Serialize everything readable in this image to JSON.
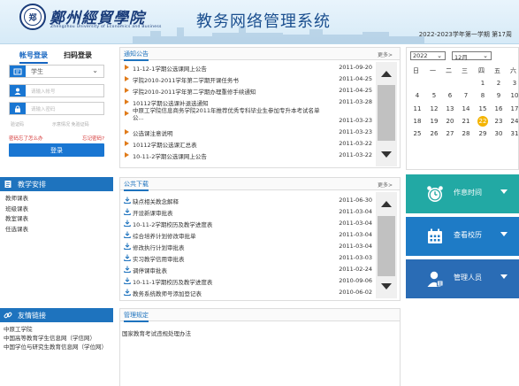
{
  "header": {
    "school_name": "鄭州經貿學院",
    "school_sub": "Zhengzhou University of Economics and Business",
    "system_title": "教务网络管理系统",
    "term_text": "2022-2023学年第一学期 第17周"
  },
  "login": {
    "tab_account": "帐号登录",
    "tab_qr": "扫码登录",
    "role_value": "学生",
    "username_placeholder": "请输入帐号",
    "password_placeholder": "请输入密码",
    "captcha_label": "验证码",
    "captcha_hint": "示意情况 免验证码",
    "link_forgot_pwd": "密码忘了怎么办",
    "link_forgot_account": "忘记密码?",
    "login_button": "登录"
  },
  "teaching": {
    "title": "教学安排",
    "items": [
      "教师课表",
      "班级课表",
      "教室课表",
      "任选课表"
    ]
  },
  "friend_links": {
    "title": "友情链接",
    "items": [
      "中原工学院",
      "中国高等教育学生信息网（学信网）",
      "中国学位与研究生教育信息网（学位网）"
    ]
  },
  "notices": {
    "title": "通知公告",
    "more": "更多>",
    "rows": [
      {
        "text": "11-12-1学期公选课网上公告",
        "date": "2011-09-20"
      },
      {
        "text": "学院2010-2011学年第二学期开课任务书",
        "date": "2011-04-25"
      },
      {
        "text": "学院2010-2011学年第二学期办理重修手续通知",
        "date": "2011-04-25"
      },
      {
        "text": "10112学期公选课补退选通知",
        "date": "2011-03-28"
      },
      {
        "text": "中原工学院信息商务学院2011年推荐优秀专科毕业生参加专升本考试名单公...",
        "date": "2011-03-23"
      },
      {
        "text": "公选课注意说明",
        "date": "2011-03-23"
      },
      {
        "text": "10112学期公选课汇总表",
        "date": "2011-03-22"
      },
      {
        "text": "10-11-2学期公选课网上公告",
        "date": "2011-03-22"
      }
    ]
  },
  "downloads": {
    "title": "公共下载",
    "more": "更多>",
    "rows": [
      {
        "text": "缺点相关教念解释",
        "date": "2011-06-30"
      },
      {
        "text": "开设新课审批表",
        "date": "2011-03-04"
      },
      {
        "text": "10-11-2学期校历及教学进度表",
        "date": "2011-03-04"
      },
      {
        "text": "综合培养计划修改审批单",
        "date": "2011-03-04"
      },
      {
        "text": "修改执行计划审批表",
        "date": "2011-03-04"
      },
      {
        "text": "实习教学信用审批表",
        "date": "2011-03-03"
      },
      {
        "text": "调停课审批表",
        "date": "2011-02-24"
      },
      {
        "text": "10-11-1学期校历及教学进度表",
        "date": "2010-09-06"
      },
      {
        "text": "教务系统教师号添加登记表",
        "date": "2010-06-02"
      }
    ]
  },
  "regulations": {
    "title": "管理规定",
    "text": "国家教育考试违规处理办法"
  },
  "calendar": {
    "year": "2022",
    "month": "12月",
    "weekdays": [
      "日",
      "一",
      "二",
      "三",
      "四",
      "五",
      "六"
    ],
    "weeks": [
      [
        "",
        "",
        "",
        "",
        "1",
        "2",
        "3"
      ],
      [
        "4",
        "5",
        "6",
        "7",
        "8",
        "9",
        "10"
      ],
      [
        "11",
        "12",
        "13",
        "14",
        "15",
        "16",
        "17"
      ],
      [
        "18",
        "19",
        "20",
        "21",
        "22",
        "23",
        "24"
      ],
      [
        "25",
        "26",
        "27",
        "28",
        "29",
        "30",
        "31"
      ]
    ],
    "today": "22"
  },
  "tiles": [
    {
      "label": "作息时间",
      "icon": "alarm-clock-icon",
      "color": "#22a9a4"
    },
    {
      "label": "查看校历",
      "icon": "calendar-icon",
      "color": "#1e7bc6"
    },
    {
      "label": "管理人员",
      "icon": "person-badge-icon",
      "color": "#2a6cb5"
    }
  ],
  "colors": {
    "primary": "#1e73be",
    "notice_marker": "#e07b1a",
    "today_highlight": "#f4b400",
    "link_red": "#d32f2f"
  }
}
